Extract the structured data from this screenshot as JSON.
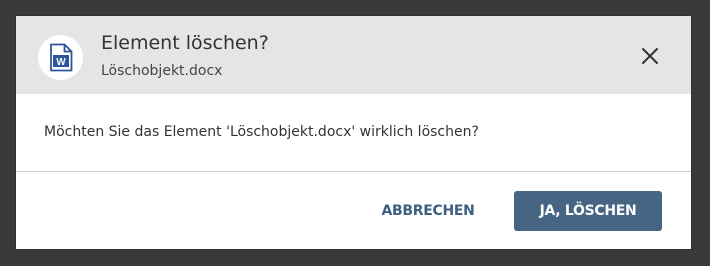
{
  "dialog": {
    "title": "Element löschen?",
    "subtitle": "Löschobjekt.docx",
    "file_icon": "word-document-icon",
    "file_icon_letter": "W",
    "close_icon": "close-icon",
    "message": "Möchten Sie das Element 'Löschobjekt.docx' wirklich löschen?",
    "cancel_label": "ABBRECHEN",
    "confirm_label": "JA, LÖSCHEN"
  },
  "colors": {
    "backdrop": "#3a3a3a",
    "header_bg": "#e5e5e5",
    "primary": "#456582",
    "cancel_text": "#3e5f7f",
    "word_blue": "#2b579a"
  }
}
